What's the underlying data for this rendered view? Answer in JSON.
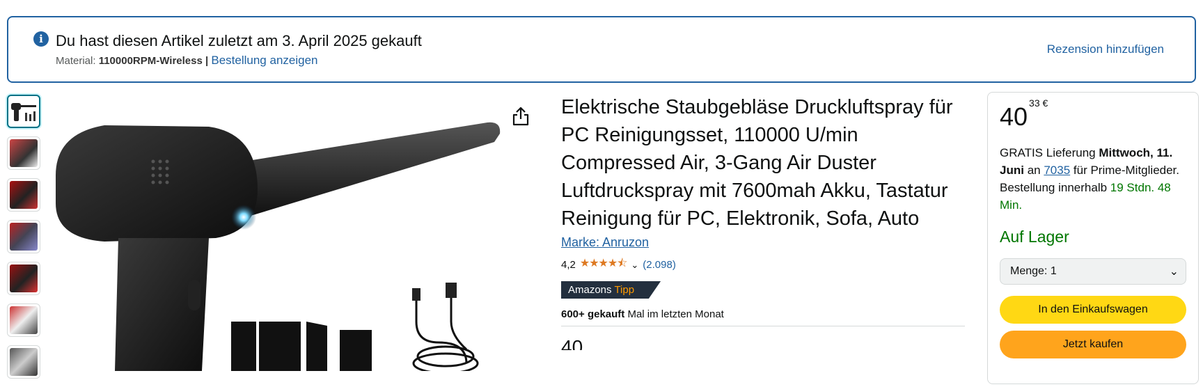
{
  "banner": {
    "info_icon": "info-icon",
    "title": "Du hast diesen Artikel zuletzt am 3. April 2025 gekauft",
    "material_label": "Material:",
    "material_value": "110000RPM-Wireless |",
    "order_link": "Bestellung anzeigen",
    "review_link": "Rezension hinzufügen"
  },
  "thumbnails": [
    {
      "name": "thumb-1",
      "color": "#2b2b2b"
    },
    {
      "name": "thumb-2",
      "color": "#7a2a2a"
    },
    {
      "name": "thumb-3",
      "color": "#8b1f1f"
    },
    {
      "name": "thumb-4",
      "color": "#3a3f8f"
    },
    {
      "name": "thumb-5",
      "color": "#7a2020"
    },
    {
      "name": "thumb-6",
      "color": "#9e2a2a"
    },
    {
      "name": "thumb-7",
      "color": "#444444"
    }
  ],
  "product": {
    "title": "Elektrische Staubgebläse Druckluftspray für PC Reinigungsset, 110000 U/min Compressed Air, 3-Gang Air Duster Luftdruckspray mit 7600mah Akku, Tastatur Reinigung für PC, Elektronik, Sofa, Auto",
    "brand": "Marke: Anruzon",
    "rating": "4,2",
    "stars": "★★★★⯪",
    "rating_count": "(2.098)",
    "badge_brand": "Amazons",
    "badge_tipp": "Tipp",
    "sold_bold": "600+ gekauft",
    "sold_rest": "Mal im letzten Monat",
    "price_peek": "40"
  },
  "buybox": {
    "price_whole": "40",
    "price_fraction": "33 €",
    "delivery_prefix": "GRATIS Lieferung",
    "delivery_date": "Mittwoch, 11. Juni",
    "delivery_an": "an",
    "delivery_zip": "7035",
    "delivery_suffix": "für Prime-Mitglieder. Bestellung innerhalb",
    "delivery_countdown": "19 Stdn. 48 Min.",
    "stock": "Auf Lager",
    "qty_label": "Menge:",
    "qty_value": "1",
    "add_to_cart": "In den Einkaufswagen",
    "buy_now": "Jetzt kaufen"
  },
  "colors": {
    "link": "#2162a1",
    "cart_button": "#ffd814",
    "buy_button": "#ffa41c",
    "in_stock": "#007600",
    "star": "#de7921"
  }
}
